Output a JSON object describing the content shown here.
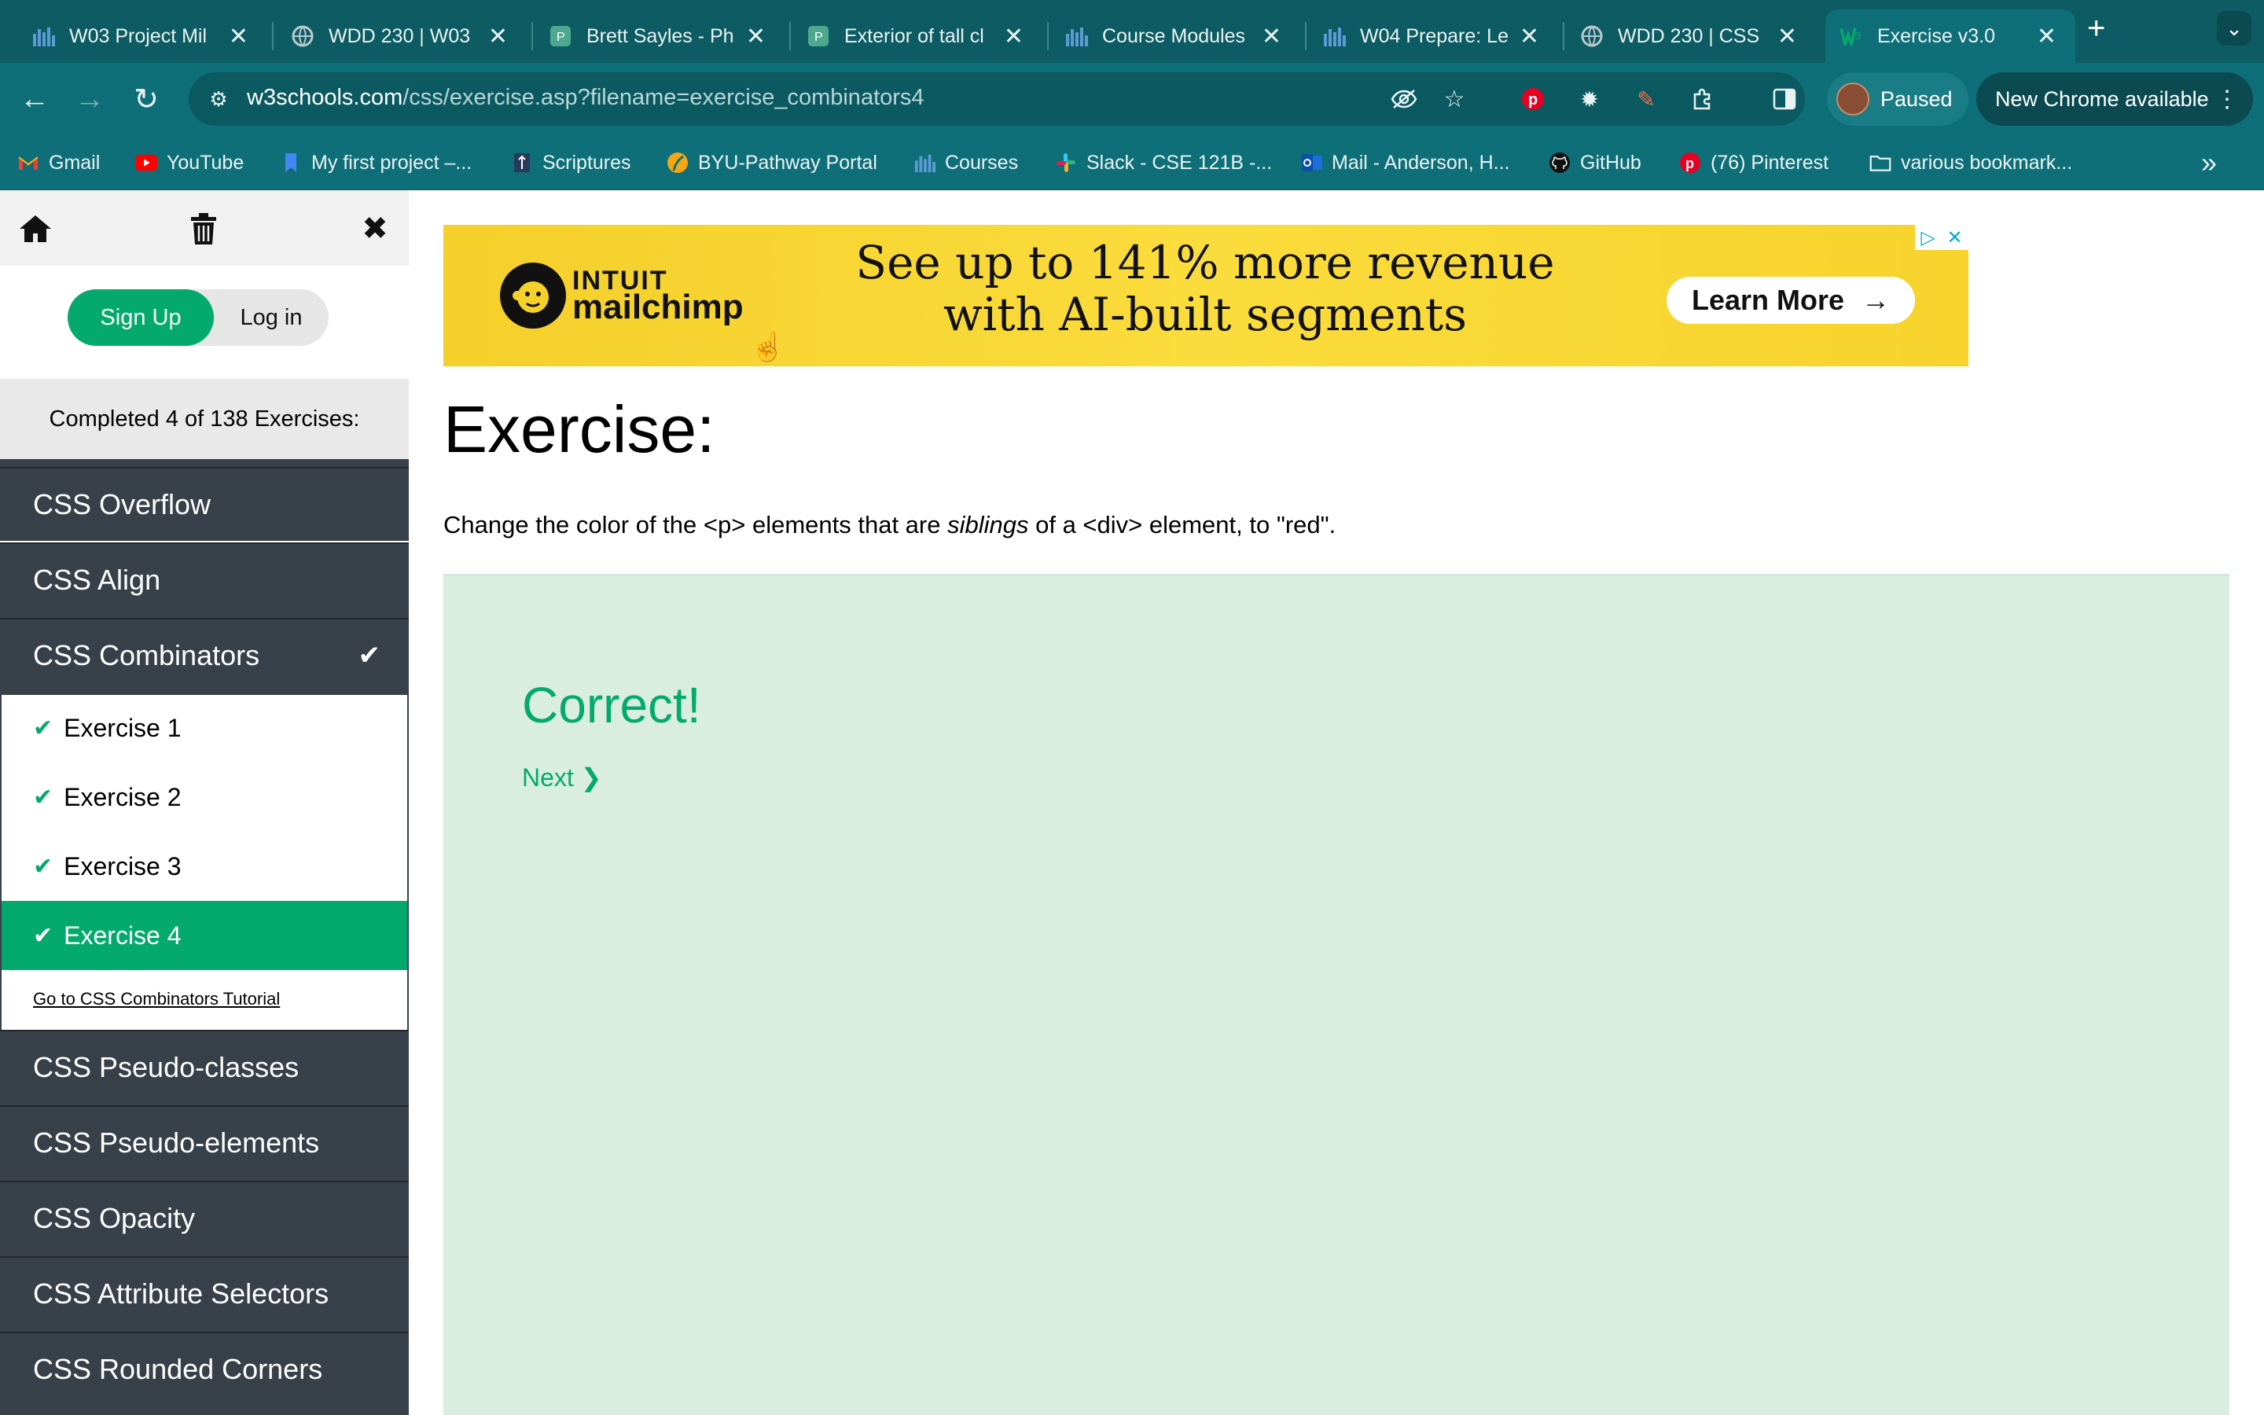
{
  "browser": {
    "tabs": [
      {
        "title": "W03 Project Mil",
        "icon": "canvas-icon"
      },
      {
        "title": "WDD 230 | W03",
        "icon": "globe-icon"
      },
      {
        "title": "Brett Sayles - Ph",
        "icon": "pexels-icon"
      },
      {
        "title": "Exterior of tall cl",
        "icon": "pexels-icon"
      },
      {
        "title": "Course Modules",
        "icon": "canvas-icon"
      },
      {
        "title": "W04 Prepare: Le",
        "icon": "canvas-icon"
      },
      {
        "title": "WDD 230 | CSS",
        "icon": "globe-icon"
      },
      {
        "title": "Exercise v3.0",
        "icon": "w3schools-icon",
        "active": true
      }
    ],
    "url_host": "w3schools.com",
    "url_path": "/css/exercise.asp?filename=exercise_combinators4",
    "profile_label": "Paused",
    "update_label": "New Chrome available",
    "bookmarks": [
      {
        "label": "Gmail",
        "icon": "gmail-icon"
      },
      {
        "label": "YouTube",
        "icon": "youtube-icon"
      },
      {
        "label": "My first project –...",
        "icon": "bookmark-icon"
      },
      {
        "label": "Scriptures",
        "icon": "scriptures-icon"
      },
      {
        "label": "BYU-Pathway Portal",
        "icon": "pathway-icon"
      },
      {
        "label": "Courses",
        "icon": "canvas-icon"
      },
      {
        "label": "Slack - CSE 121B -...",
        "icon": "slack-icon"
      },
      {
        "label": "Mail - Anderson, H...",
        "icon": "outlook-icon"
      },
      {
        "label": "GitHub",
        "icon": "github-icon"
      },
      {
        "label": "(76) Pinterest",
        "icon": "pinterest-icon"
      },
      {
        "label": "various bookmark...",
        "icon": "folder-icon"
      }
    ]
  },
  "sidebar": {
    "signup_label": "Sign Up",
    "login_label": "Log in",
    "progress_text": "Completed 4 of 138 Exercises:",
    "menu_before": [
      "CSS Overflow",
      "CSS Align",
      "CSS Combinators"
    ],
    "exercises": [
      "Exercise 1",
      "Exercise 2",
      "Exercise 3",
      "Exercise 4"
    ],
    "tutorial_link": "Go to CSS Combinators Tutorial",
    "menu_after": [
      "CSS Pseudo-classes",
      "CSS Pseudo-elements",
      "CSS Opacity",
      "CSS Attribute Selectors",
      "CSS Rounded Corners"
    ]
  },
  "ad": {
    "brand_top": "INTUIT",
    "brand_bottom": "mailchimp",
    "headline_1": "See up to 141% more revenue",
    "headline_2": "with AI-built segments",
    "cta": "Learn More"
  },
  "main": {
    "title": "Exercise:",
    "desc_part1": "Change the color of the <p> elements that are ",
    "desc_italic": "siblings",
    "desc_part2": " of a <div> element, to \"red\".",
    "result_text": "Correct!",
    "next_label": "Next ❯"
  },
  "colors": {
    "accent": "#04aa6d",
    "sidebar_bg": "#384149",
    "chrome_bg": "#0f6f78",
    "result_bg": "#d9eee1"
  }
}
